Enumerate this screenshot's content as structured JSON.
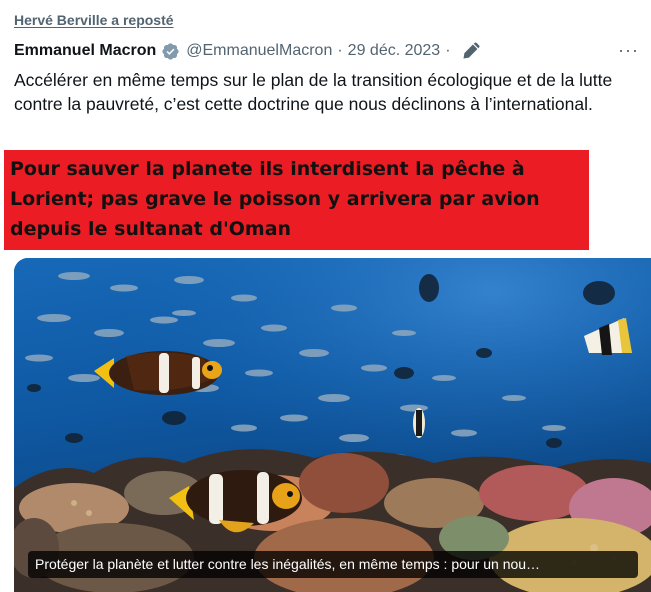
{
  "repost": {
    "label": "Hervé Berville a reposté"
  },
  "tweet": {
    "author_name": "Emmanuel Macron",
    "handle": "@EmmanuelMacron",
    "separator": "·",
    "date": "29 déc. 2023",
    "more_label": "···",
    "text": "Accélérer en même temps sur le plan de la transition écologique et de la lutte contre la pauvreté, c’est cette doctrine que nous déclinons à l’international.",
    "icons": {
      "verified": "verified-badge-icon",
      "edited": "pencil-edit-icon",
      "more": "more-options-icon"
    }
  },
  "overlay": {
    "text": "Pour sauver la planete ils interdisent la pêche à Lorient; pas grave le poisson y arrivera par avion depuis le sultanat d'Oman",
    "background_color": "#ec1c24"
  },
  "media": {
    "caption": "Protéger la planète et lutter contre les inégalités, en même temps : pour un nou…"
  },
  "colors": {
    "text_primary": "#0f1419",
    "text_secondary": "#536471",
    "verified_blue": "#829aab"
  }
}
